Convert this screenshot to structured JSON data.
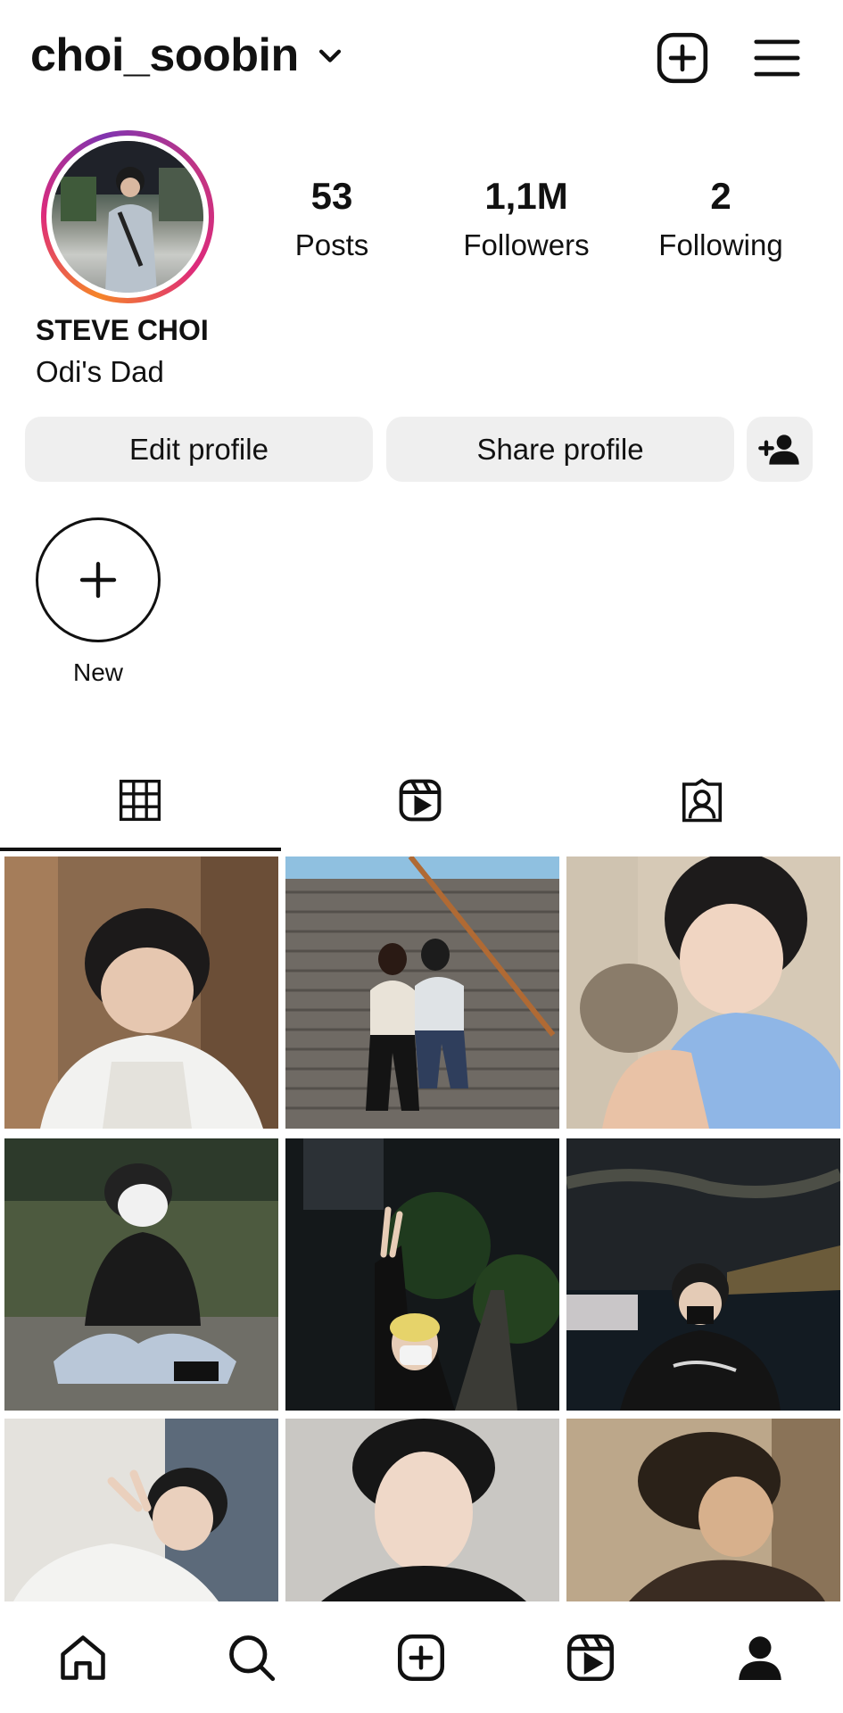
{
  "header": {
    "username": "choi_soobin",
    "icons": [
      "chevron-down-icon",
      "create-post-icon",
      "menu-icon"
    ]
  },
  "profile": {
    "stats": [
      {
        "value": "53",
        "label": "Posts"
      },
      {
        "value": "1,1M",
        "label": "Followers"
      },
      {
        "value": "2",
        "label": "Following"
      }
    ],
    "full_name": "STEVE CHOI",
    "bio": "Odi's Dad"
  },
  "buttons": {
    "edit_label": "Edit profile",
    "share_label": "Share profile"
  },
  "highlights": {
    "new_label": "New"
  },
  "tabs": [
    "grid-icon",
    "reels-icon",
    "tagged-icon"
  ],
  "posts": [
    {
      "subject": "smiling person in white shirt"
    },
    {
      "subject": "two people sitting on stairs"
    },
    {
      "subject": "person holding hedgehog"
    },
    {
      "subject": "person in mask sitting on rocks"
    },
    {
      "subject": "peace sign at night park"
    },
    {
      "subject": "person at night by river"
    },
    {
      "subject": "person doing peace sign"
    },
    {
      "subject": "portrait with dark hair"
    },
    {
      "subject": "person looking down, sepia"
    }
  ],
  "bottom_nav": [
    "home-icon",
    "search-icon",
    "create-icon",
    "reels-icon",
    "profile-icon"
  ]
}
